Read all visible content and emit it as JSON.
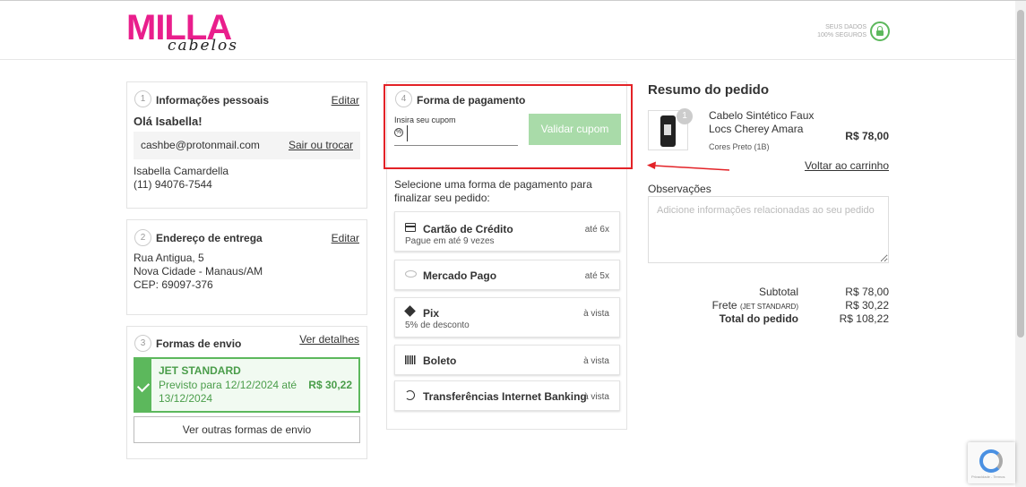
{
  "header": {
    "logo_main": "MILLA",
    "logo_sub": "cabelos",
    "secure_line1": "SEUS DADOS",
    "secure_line2": "100% SEGUROS"
  },
  "personal": {
    "step": "1",
    "title": "Informações pessoais",
    "edit_label": "Editar",
    "greeting": "Olá Isabella!",
    "email": "cashbe@protonmail.com",
    "switch_label": "Sair ou trocar",
    "name": "Isabella Camardella",
    "phone": "(11) 94076-7544"
  },
  "address": {
    "step": "2",
    "title": "Endereço de entrega",
    "edit_label": "Editar",
    "street": "Rua Antigua, 5",
    "city": "Nova Cidade - Manaus/AM",
    "zip": "CEP: 69097-376"
  },
  "shipping": {
    "step": "3",
    "title": "Formas de envio",
    "details_label": "Ver detalhes",
    "method_name": "JET STANDARD",
    "method_eta_line1": "Previsto para 12/12/2024 até",
    "method_eta_line2": "13/12/2024",
    "method_price": "R$ 30,22",
    "other_label": "Ver outras formas de envio"
  },
  "payment": {
    "step": "4",
    "title": "Forma de pagamento",
    "coupon_label": "Insira seu cupom",
    "coupon_value": "",
    "validate_label": "Validar cupom",
    "instruction": "Selecione uma forma de pagamento para finalizar seu pedido:",
    "options": [
      {
        "name": "Cartão de Crédito",
        "sub": "Pague em até 9 vezes",
        "right": "até 6x",
        "icon": "credit-card-icon"
      },
      {
        "name": "Mercado Pago",
        "sub": "",
        "right": "até 5x",
        "icon": "mercado-pago-icon"
      },
      {
        "name": "Pix",
        "sub": "5% de desconto",
        "right": "à vista",
        "icon": "pix-icon"
      },
      {
        "name": "Boleto",
        "sub": "",
        "right": "à vista",
        "icon": "barcode-icon"
      },
      {
        "name": "Transferências Internet Banking",
        "sub": "",
        "right": "à vista",
        "icon": "bank-transfer-icon"
      }
    ]
  },
  "summary": {
    "title": "Resumo do pedido",
    "product_qty": "1",
    "product_name_line1": "Cabelo Sintético Faux",
    "product_name_line2": "Locs Cherey Amara",
    "product_variant": "Cores Preto (1B)",
    "product_price": "R$ 78,00",
    "back_to_cart": "Voltar ao carrinho",
    "notes_label": "Observações",
    "notes_placeholder": "Adicione informações relacionadas ao seu pedido",
    "subtotal_label": "Subtotal",
    "subtotal_value": "R$ 78,00",
    "freight_label": "Frete",
    "freight_method": "(JET STANDARD)",
    "freight_value": "R$ 30,22",
    "total_label": "Total do pedido",
    "total_value": "R$ 108,22"
  },
  "colors": {
    "brand_pink": "#e91e8c",
    "success_green": "#5cb85c",
    "highlight_red": "#e32227",
    "validate_button": "#a9dba9"
  }
}
